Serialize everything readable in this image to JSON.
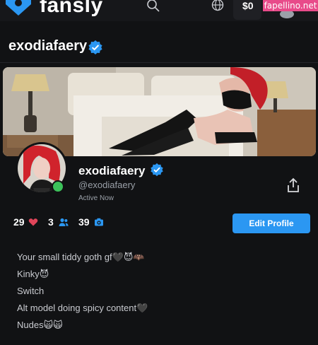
{
  "nav": {
    "brand": "fansly",
    "wallet_amount": "$0",
    "watermark": "fapellino.net"
  },
  "profile": {
    "page_title": "exodiafaery",
    "display_name": "exodiafaery",
    "handle": "@exodiafaery",
    "status": "Active Now",
    "likes": "29",
    "subscribers": "3",
    "media": "39",
    "edit_button": "Edit Profile"
  },
  "bio": {
    "line1": "Your small tiddy goth gf",
    "line1_emoji": "🖤😈🦇",
    "line2": "Kinky",
    "line2_emoji": "😈",
    "line3": "Switch",
    "line4": "Alt model doing spicy content",
    "line4_emoji": "🖤",
    "line5": "Nudes",
    "line5_emoji": "🙀🙀"
  },
  "colors": {
    "background": "#111214",
    "accent": "#2b97f2",
    "online": "#3cc15a",
    "heart": "#e0455a"
  },
  "icons": [
    "fansly-logo-icon",
    "search-icon",
    "globe-icon",
    "verified-badge-icon",
    "share-icon",
    "heart-icon",
    "users-icon",
    "camera-icon"
  ]
}
